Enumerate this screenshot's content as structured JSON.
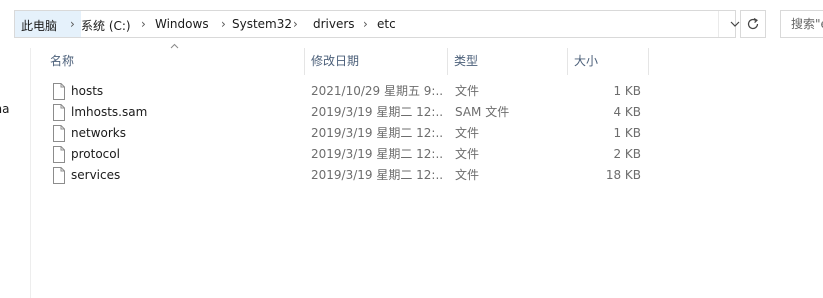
{
  "address_bar": {
    "breadcrumbs": [
      "此电脑",
      "系统 (C:)",
      "Windows",
      "System32",
      "drivers",
      "etc"
    ],
    "separator": "›"
  },
  "search": {
    "placeholder": "搜索\"e"
  },
  "nav": {
    "partial_item": "rsona"
  },
  "columns": {
    "name": "名称",
    "date": "修改日期",
    "type": "类型",
    "size": "大小"
  },
  "files": [
    {
      "name": "hosts",
      "date": "2021/10/29 星期五 9:...",
      "type": "文件",
      "size": "1 KB"
    },
    {
      "name": "lmhosts.sam",
      "date": "2019/3/19 星期二 12:...",
      "type": "SAM 文件",
      "size": "4 KB"
    },
    {
      "name": "networks",
      "date": "2019/3/19 星期二 12:...",
      "type": "文件",
      "size": "1 KB"
    },
    {
      "name": "protocol",
      "date": "2019/3/19 星期二 12:...",
      "type": "文件",
      "size": "2 KB"
    },
    {
      "name": "services",
      "date": "2019/3/19 星期二 12:...",
      "type": "文件",
      "size": "18 KB"
    }
  ],
  "icons": {
    "file": "file-icon",
    "dropdown": "chevron-down-icon",
    "refresh": "refresh-icon",
    "sort": "sort-up-icon"
  }
}
